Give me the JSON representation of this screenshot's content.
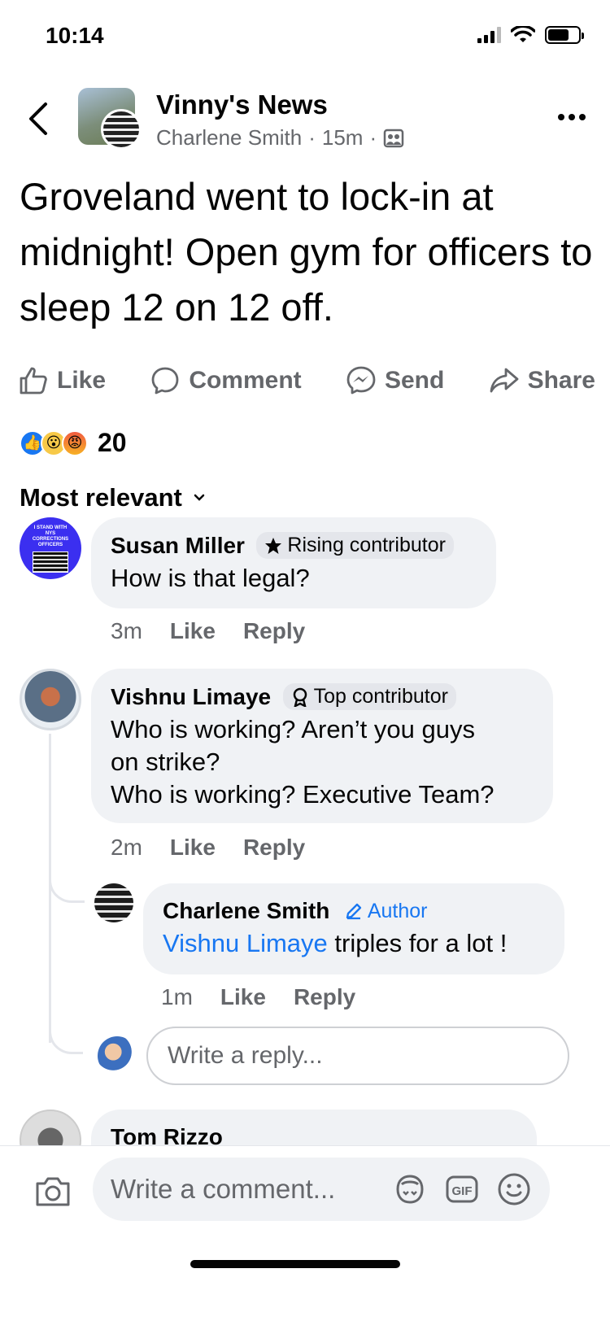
{
  "status_bar": {
    "time": "10:14"
  },
  "header": {
    "group_name": "Vinny's News",
    "author": "Charlene Smith",
    "time_ago": "15m",
    "separator": "·"
  },
  "post": {
    "text": "Groveland went to lock-in at midnight! Open gym for officers to sleep 12 on 12 off."
  },
  "actions": {
    "like": "Like",
    "comment": "Comment",
    "send": "Send",
    "share": "Share"
  },
  "reactions": {
    "count": "20",
    "types": [
      "like",
      "wow",
      "angry"
    ]
  },
  "sort": {
    "label": "Most relevant"
  },
  "comments": [
    {
      "name": "Susan Miller",
      "badge": "Rising contributor",
      "badge_icon": "star-icon",
      "text": "How is that legal?",
      "time": "3m",
      "like": "Like",
      "reply": "Reply"
    },
    {
      "name": "Vishnu Limaye",
      "badge": "Top contributor",
      "badge_icon": "award-icon",
      "text_lines": [
        "Who is working?  Aren’t you guys",
        "on strike?",
        "Who is working? Executive Team?"
      ],
      "time": "2m",
      "like": "Like",
      "reply": "Reply",
      "replies": [
        {
          "name": "Charlene Smith",
          "badge": "Author",
          "badge_icon": "pencil-icon",
          "mention": "Vishnu Limaye",
          "text": " triples for a lot !",
          "time": "1m",
          "like": "Like",
          "reply": "Reply"
        }
      ]
    },
    {
      "name": "Tom Rizzo"
    }
  ],
  "reply_box": {
    "placeholder": "Write a reply..."
  },
  "composer": {
    "placeholder": "Write a comment...",
    "gif_label": "GIF"
  },
  "colors": {
    "accent": "#1877f2",
    "secondary_text": "#65676b",
    "bubble": "#f0f2f5"
  }
}
